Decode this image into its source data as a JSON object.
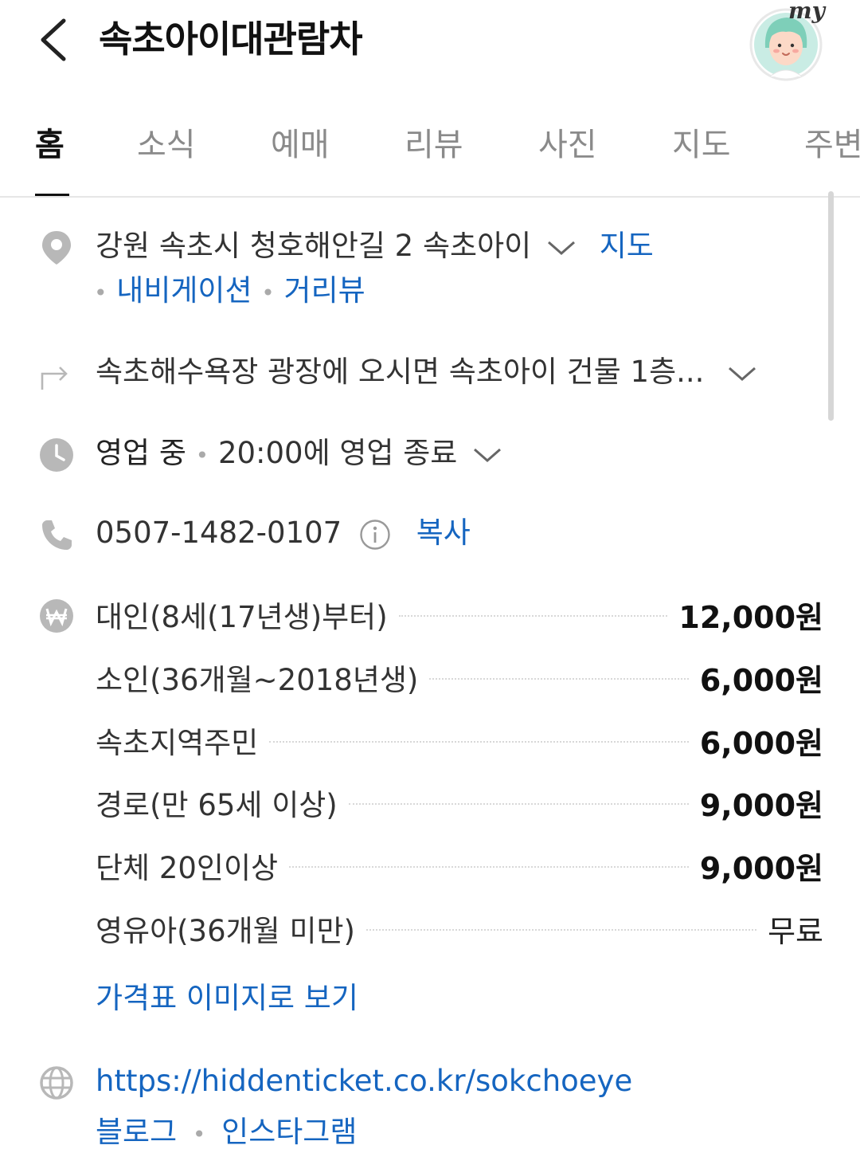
{
  "header": {
    "title": "속초아이대관람차",
    "avatar_label": "my"
  },
  "tabs": [
    "홈",
    "소식",
    "예매",
    "리뷰",
    "사진",
    "지도",
    "주변"
  ],
  "address": {
    "text": "강원 속초시 청호해안길 2 속초아이",
    "map_link": "지도",
    "navigation_link": "내비게이션",
    "street_view_link": "거리뷰"
  },
  "directions": {
    "text": "속초해수욕장 광장에 오시면 속초아이 건물 1층..."
  },
  "hours": {
    "status": "영업 중",
    "detail": "20:00에 영업 종료"
  },
  "phone": {
    "number": "0507-1482-0107",
    "copy_label": "복사"
  },
  "prices": {
    "items": [
      {
        "label": "대인(8세(17년생)부터)",
        "value": "12,000원"
      },
      {
        "label": "소인(36개월~2018년생)",
        "value": "6,000원"
      },
      {
        "label": "속초지역주민",
        "value": "6,000원"
      },
      {
        "label": "경로(만 65세 이상)",
        "value": "9,000원"
      },
      {
        "label": "단체 20인이상",
        "value": "9,000원"
      },
      {
        "label": "영유아(36개월 미만)",
        "value": "무료"
      }
    ],
    "image_link": "가격표 이미지로 보기"
  },
  "website": {
    "url": "https://hiddenticket.co.kr/sokchoeye",
    "blog_link": "블로그",
    "instagram_link": "인스타그램"
  },
  "colors": {
    "link": "#1565c0",
    "icon": "#b8b8b8",
    "text": "#333333"
  }
}
